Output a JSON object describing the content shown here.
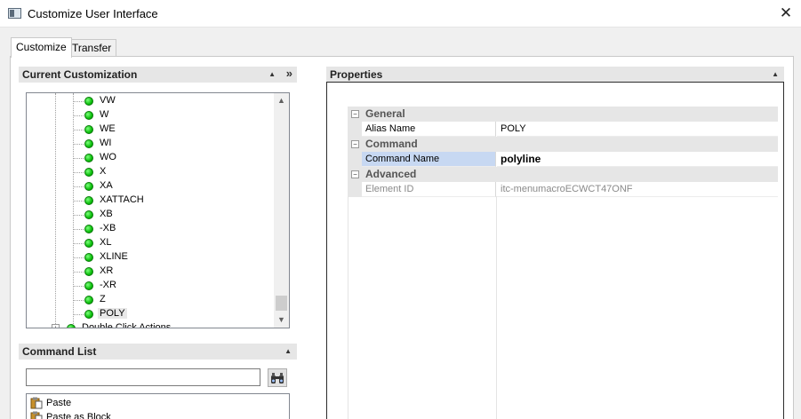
{
  "window": {
    "title": "Customize User Interface",
    "close_glyph": "✕",
    "icon": "app-window-icon"
  },
  "tabs": [
    {
      "label": "Customize",
      "active": true
    },
    {
      "label": "Transfer",
      "active": false
    }
  ],
  "current_customization": {
    "header": "Current Customization",
    "collapse_glyph": "▲",
    "expand_glyph": "»",
    "items": [
      "VW",
      "W",
      "WE",
      "WI",
      "WO",
      "X",
      "XA",
      "XATTACH",
      "XB",
      "-XB",
      "XL",
      "XLINE",
      "XR",
      "-XR",
      "Z",
      "POLY"
    ],
    "selected_item": "POLY",
    "next_node": "Double Click Actions",
    "scroll_up": "▲",
    "scroll_down": "▼"
  },
  "command_list": {
    "header": "Command List",
    "collapse_glyph": "▲",
    "search_value": "",
    "search_placeholder": "",
    "items": [
      "Paste",
      "Paste as Block"
    ]
  },
  "properties": {
    "header": "Properties",
    "collapse_glyph": "▲",
    "categories": [
      {
        "title": "General",
        "rows": [
          {
            "name": "Alias Name",
            "value": "POLY",
            "selected": false,
            "readonly": false,
            "bold": false
          }
        ]
      },
      {
        "title": "Command",
        "rows": [
          {
            "name": "Command Name",
            "value": "polyline",
            "selected": true,
            "readonly": false,
            "bold": true
          }
        ]
      },
      {
        "title": "Advanced",
        "rows": [
          {
            "name": "Element ID",
            "value": "itc-menumacroECWCT47ONF",
            "selected": false,
            "readonly": true,
            "bold": false
          }
        ]
      }
    ],
    "expander_glyph": "−"
  },
  "colors": {
    "selection": "#c7d8f2",
    "category_bg": "#e6e6e6",
    "status_green": "#0bbf0b"
  }
}
